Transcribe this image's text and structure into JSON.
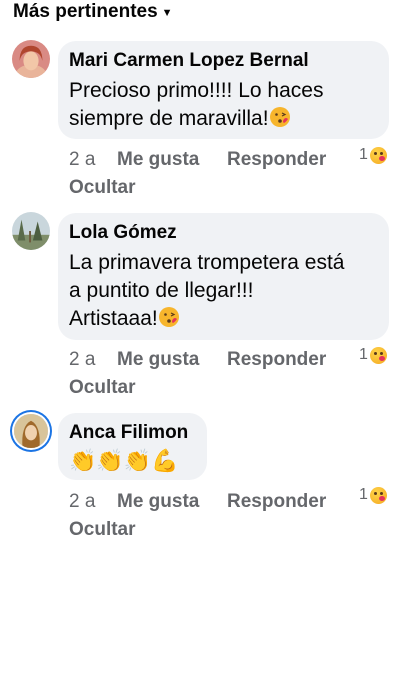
{
  "sort": {
    "label": "Más pertinentes",
    "chevron": "chevron-down-icon"
  },
  "comments": [
    {
      "author": "Mari Carmen Lopez Bernal",
      "text_line1": "Precioso primo!!!! Lo haces",
      "text_line2": "siempre de maravilla!",
      "time": "2 a",
      "like": "Me gusta",
      "reply": "Responder",
      "hide": "Ocultar",
      "reaction_count": "1",
      "reaction_icon": "kiss-face-icon"
    },
    {
      "author": "Lola Gómez",
      "text_line1": "La primavera trompetera está",
      "text_line2": "a puntito de llegar!!!",
      "text_line3": "Artistaaa!",
      "time": "2 a",
      "like": "Me gusta",
      "reply": "Responder",
      "hide": "Ocultar",
      "reaction_count": "1",
      "reaction_icon": "kiss-face-icon"
    },
    {
      "author": "Anca Filimon",
      "text_line1": "👏👏👏💪",
      "time": "2 a",
      "like": "Me gusta",
      "reply": "Responder",
      "hide": "Ocultar",
      "reaction_count": "1",
      "reaction_icon": "kiss-face-icon"
    }
  ],
  "colors": {
    "bubble": "#f0f2f5",
    "secondary_text": "#65676b",
    "accent_ring": "#1b74e4"
  }
}
